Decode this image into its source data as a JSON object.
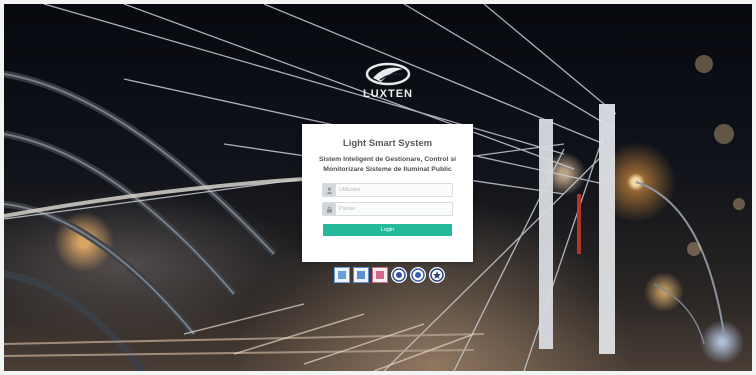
{
  "brand": {
    "name": "LUXTEN",
    "logo_icon": "luxten-swoosh-icon"
  },
  "login": {
    "title": "Light Smart System",
    "subtitle": "Sistem Inteligent de Gestionare, Control si Monitorizare Sisteme de Iluminat Public",
    "username_placeholder": "Utilizator",
    "password_placeholder": "Parola",
    "username_icon": "user-icon",
    "password_icon": "lock-icon",
    "button_label": "Login"
  },
  "certifications": [
    {
      "icon": "certification-badge-icon",
      "color": "#6aa0d8"
    },
    {
      "icon": "certification-badge-icon",
      "color": "#5b8fd0"
    },
    {
      "icon": "certification-badge-icon",
      "color": "#d46a8c"
    },
    {
      "icon": "certification-seal-icon",
      "color": "#2f4fa0"
    },
    {
      "icon": "certification-seal-icon",
      "color": "#3b5cb0"
    },
    {
      "icon": "certification-seal-icon",
      "color": "#2a3f7c"
    }
  ],
  "colors": {
    "accent": "#24b99a",
    "card_background": "#ffffff",
    "title_text": "#555b61"
  }
}
